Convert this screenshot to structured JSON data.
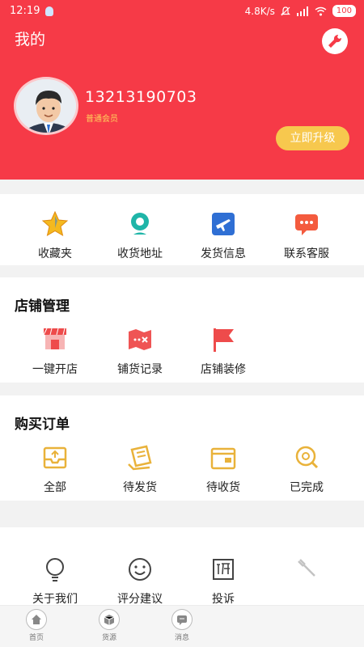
{
  "status_bar": {
    "time": "12:19",
    "network_speed": "4.8K/s",
    "battery": "100"
  },
  "header": {
    "title": "我的",
    "phone": "13213190703",
    "member_level": "普通会员",
    "upgrade_label": "立即升级"
  },
  "quick_menu": {
    "items": [
      {
        "label": "收藏夹",
        "icon": "star-icon"
      },
      {
        "label": "收货地址",
        "icon": "location-icon"
      },
      {
        "label": "发货信息",
        "icon": "plane-icon"
      },
      {
        "label": "联系客服",
        "icon": "chat-icon"
      }
    ]
  },
  "store": {
    "title": "店铺管理",
    "items": [
      {
        "label": "一键开店",
        "icon": "shop-icon"
      },
      {
        "label": "铺货记录",
        "icon": "map-icon"
      },
      {
        "label": "店铺装修",
        "icon": "flag-icon"
      }
    ]
  },
  "orders": {
    "title": "购买订单",
    "items": [
      {
        "label": "全部",
        "icon": "inbox-icon"
      },
      {
        "label": "待发货",
        "icon": "box-icon"
      },
      {
        "label": "待收货",
        "icon": "wallet-icon"
      },
      {
        "label": "已完成",
        "icon": "check-search-icon"
      }
    ]
  },
  "more": {
    "items": [
      {
        "label": "关于我们",
        "icon": "bulb-icon"
      },
      {
        "label": "评分建议",
        "icon": "smile-icon"
      },
      {
        "label": "投诉",
        "icon": "complaint-icon"
      }
    ]
  },
  "tabbar": {
    "items": [
      {
        "label": "首页",
        "icon": "home-icon"
      },
      {
        "label": "货源",
        "icon": "supply-box-icon"
      },
      {
        "label": "消息",
        "icon": "message-icon"
      }
    ]
  },
  "colors": {
    "brand_red": "#f63a47",
    "accent_yellow": "#f7c84e",
    "order_gold": "#e9b23a"
  }
}
